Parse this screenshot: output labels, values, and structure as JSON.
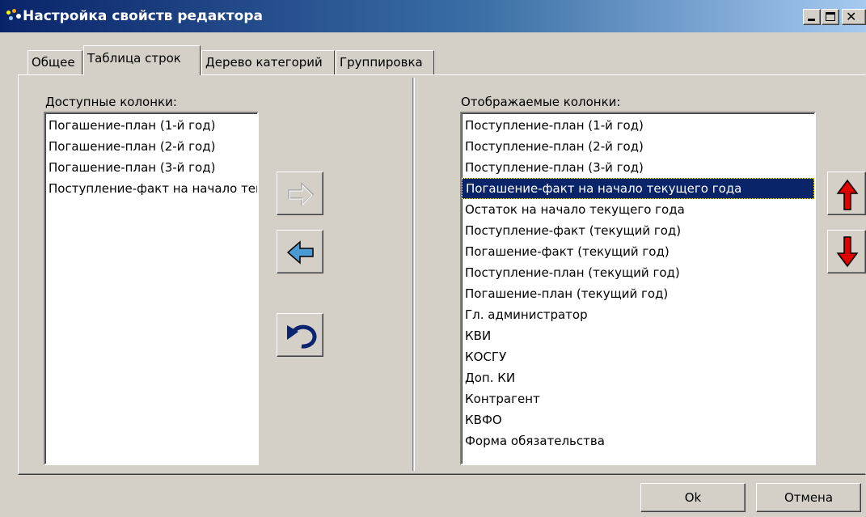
{
  "window": {
    "title": "Настройка свойств редактора"
  },
  "tabs": [
    {
      "label": "Общее"
    },
    {
      "label": "Таблица строк"
    },
    {
      "label": "Дерево категорий"
    },
    {
      "label": "Группировка"
    }
  ],
  "active_tab": "Таблица строк",
  "available": {
    "label": "Доступные колонки:",
    "items": [
      "Погашение-план  (1-й год)",
      "Погашение-план  (2-й год)",
      "Погашение-план  (3-й год)",
      "Поступление-факт на начало текущего года"
    ]
  },
  "displayed": {
    "label": "Отображаемые колонки:",
    "selected_index": 3,
    "items": [
      "Поступление-план (1-й год)",
      "Поступление-план (2-й год)",
      "Поступление-план (3-й год)",
      "Погашение-факт на начало текущего года",
      "Остаток на начало текущего года",
      "Поступление-факт (текущий год)",
      "Погашение-факт (текущий год)",
      "Поступление-план (текущий год)",
      "Погашение-план (текущий год)",
      "Гл. администратор",
      "КВИ",
      "КОСГУ",
      "Доп. КИ",
      "Контрагент",
      "КВФО",
      "Форма обязательства"
    ]
  },
  "transfer_buttons": {
    "add_icon": "arrow-right-icon",
    "remove_icon": "arrow-left-icon",
    "undo_icon": "undo-icon",
    "add_enabled": false
  },
  "order_buttons": {
    "up_icon": "arrow-up-icon",
    "down_icon": "arrow-down-icon"
  },
  "footer": {
    "ok_label": "Ok",
    "cancel_label": "Отмена"
  },
  "colors": {
    "titlebar_start": "#0a246a",
    "titlebar_end": "#a6caf0",
    "selection": "#0a246a",
    "arrow_blue": "#4a9ad4",
    "arrow_red": "#e00000",
    "face": "#d4d0c8"
  }
}
